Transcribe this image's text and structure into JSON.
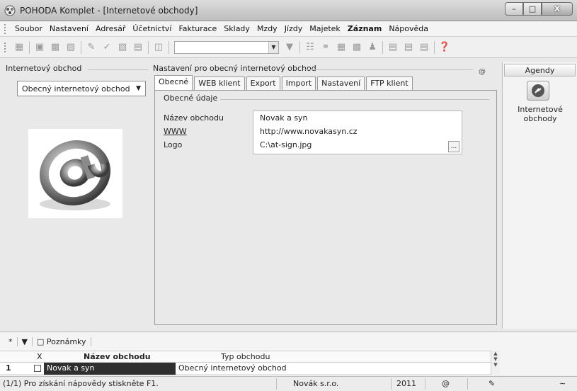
{
  "window": {
    "title": "POHODA Komplet - [Internetové obchody]",
    "controls": [
      "minimize-icon",
      "maximize-icon",
      "close-icon"
    ]
  },
  "menu": {
    "items": [
      "Soubor",
      "Nastavení",
      "Adresář",
      "Účetnictví",
      "Fakturace",
      "Sklady",
      "Mzdy",
      "Jízdy",
      "Majetek",
      "Záznam",
      "Nápověda"
    ]
  },
  "left_panel": {
    "header": "Internetový obchod",
    "selected_shop": "Obecný internetový obchod"
  },
  "settings": {
    "header": "Nastavení pro obecný internetový obchod",
    "header_icon": "@",
    "tabs": [
      "Obecné",
      "WEB klient",
      "Export",
      "Import",
      "Nastavení",
      "FTP klient"
    ],
    "active_tab": "Obecné",
    "group_title": "Obecné údaje",
    "fields": {
      "name_label": "Název obchodu",
      "name_value": "Novak a syn",
      "www_label": "WWW",
      "www_value": "http://www.novakasyn.cz",
      "logo_label": "Logo",
      "logo_value": "C:\\at-sign.jpg",
      "browse_label": "..."
    }
  },
  "agendy": {
    "header": "Agendy",
    "item_label_line1": "Internetové",
    "item_label_line2": "obchody"
  },
  "grid": {
    "tab_star": "*",
    "tab_notes": "Poznámky",
    "columns": {
      "x": "X",
      "name": "Název obchodu",
      "type": "Typ obchodu"
    },
    "rows": [
      {
        "num": "1",
        "name": "Novak a syn",
        "type": "Obecný internetový obchod"
      }
    ]
  },
  "status": {
    "help": "(1/1) Pro získání nápovědy stiskněte F1.",
    "company": "Novák s.r.o.",
    "year": "2011",
    "at": "@"
  }
}
